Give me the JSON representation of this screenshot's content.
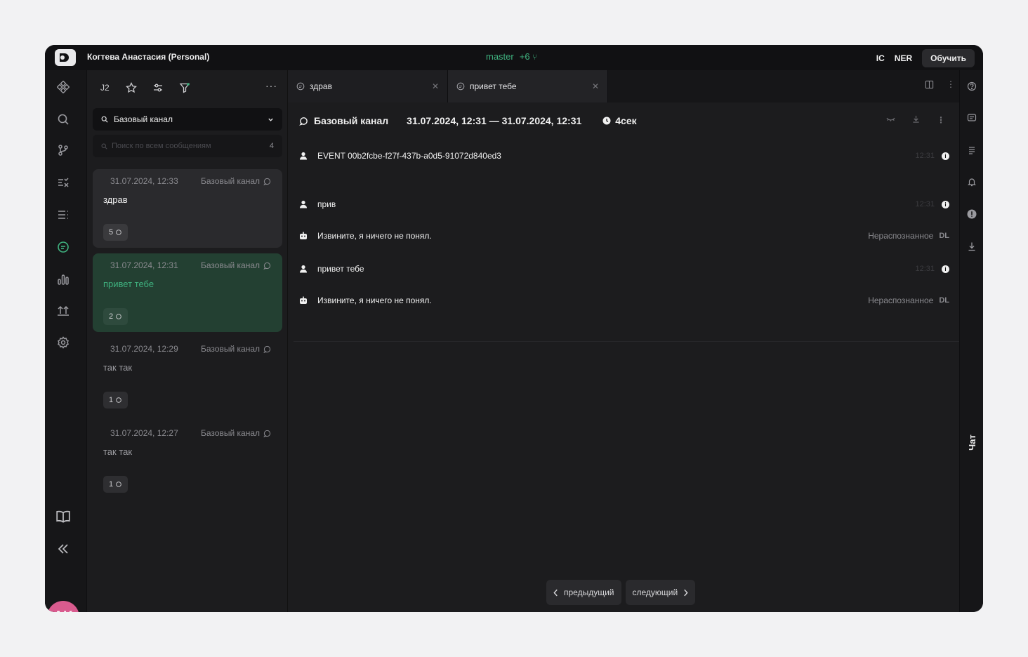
{
  "topbar": {
    "user": "Когтева Анастасия (Personal)",
    "branch": "master",
    "branch_count": "+6",
    "tag_ic": "IC",
    "tag_ner": "NER",
    "train_label": "Обучить"
  },
  "leftrail": {
    "avatar_initials": "AK"
  },
  "sessions": {
    "toolbar_label": "J2",
    "channel_select": "Базовый канал",
    "search_placeholder": "Поиск по всем сообщениям",
    "search_count": "4",
    "items": [
      {
        "date": "31.07.2024, 12:33",
        "channel": "Базовый канал",
        "title": "здрав",
        "count": "5"
      },
      {
        "date": "31.07.2024, 12:31",
        "channel": "Базовый канал",
        "title": "привет тебе",
        "count": "2"
      },
      {
        "date": "31.07.2024, 12:29",
        "channel": "Базовый канал",
        "title": "так так",
        "count": "1"
      },
      {
        "date": "31.07.2024, 12:27",
        "channel": "Базовый канал",
        "title": "так так",
        "count": "1"
      }
    ]
  },
  "tabs": [
    {
      "label": "здрав"
    },
    {
      "label": "привет тебе"
    }
  ],
  "chat": {
    "channel": "Базовый канал",
    "range": "31.07.2024, 12:31 — 31.07.2024, 12:31",
    "duration": "4сек",
    "messages": [
      {
        "text": "EVENT 00b2fcbe-f27f-437b-a0d5-91072d840ed3",
        "time": "12:31"
      },
      {
        "text": "прив",
        "time": "12:31"
      },
      {
        "text": "Извините, я ничего не понял.",
        "meta": "Нераспознанное",
        "tag": "DL"
      },
      {
        "text": "привет тебе",
        "time": "12:31"
      },
      {
        "text": "Извините, я ничего не понял.",
        "meta": "Нераспознанное",
        "tag": "DL"
      }
    ]
  },
  "pager": {
    "prev": "предыдущий",
    "next": "следующий"
  },
  "rightrail": {
    "chat_label": "Чат"
  },
  "colors": {
    "accent": "#3fb27f",
    "avatar": "#d95b8e",
    "active_card": "#234032"
  }
}
